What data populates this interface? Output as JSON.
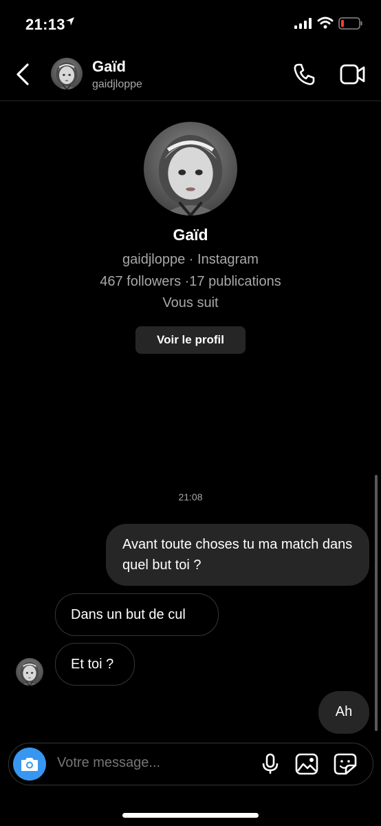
{
  "status_bar": {
    "time": "21:13"
  },
  "header": {
    "name": "Gaïd",
    "username": "gaidjloppe"
  },
  "profile": {
    "name": "Gaïd",
    "subtitle": "gaidjloppe · Instagram",
    "stats": "467 followers ·17 publications",
    "relation": "Vous suit",
    "view_button": "Voir le profil"
  },
  "thread": {
    "timestamp": "21:08",
    "messages": [
      {
        "direction": "sent",
        "text": "Avant toute choses tu ma match dans quel but toi ?"
      },
      {
        "direction": "received",
        "text": "Dans un but de cul"
      },
      {
        "direction": "received",
        "text": "Et toi ?"
      },
      {
        "direction": "sent",
        "text": "Ah"
      }
    ]
  },
  "composer": {
    "placeholder": "Votre message..."
  },
  "colors": {
    "background": "#000000",
    "sent_bubble": "#262626",
    "camera_button": "#3797f0",
    "secondary_text": "#a8a8a8"
  },
  "icons": [
    "back-icon",
    "phone-icon",
    "video-icon",
    "camera-icon",
    "mic-icon",
    "gallery-icon",
    "sticker-icon"
  ]
}
